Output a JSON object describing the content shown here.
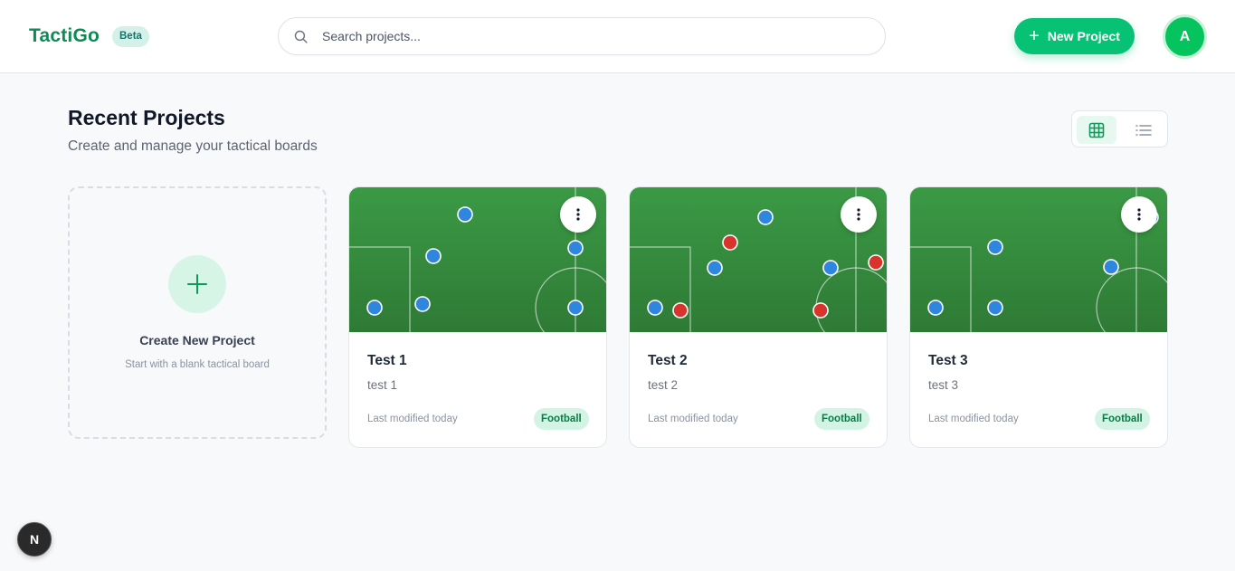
{
  "header": {
    "logo": "TactiGo",
    "badge": "Beta",
    "search_placeholder": "Search projects...",
    "new_project_label": "New Project",
    "avatar_initial": "A"
  },
  "main": {
    "title": "Recent Projects",
    "subtitle": "Create and manage your tactical boards",
    "view_modes": [
      "grid",
      "list"
    ],
    "active_view": "grid"
  },
  "create_card": {
    "title": "Create New Project",
    "subtitle": "Start with a blank tactical board"
  },
  "projects": [
    {
      "title": "Test 1",
      "description": "test 1",
      "modified": "Last modified today",
      "sport": "Football"
    },
    {
      "title": "Test 2",
      "description": "test 2",
      "modified": "Last modified today",
      "sport": "Football"
    },
    {
      "title": "Test 3",
      "description": "test 3",
      "modified": "Last modified today",
      "sport": "Football"
    }
  ],
  "dev_badge": "N",
  "colors": {
    "brand": "#0e8a55",
    "accent": "#07c275",
    "pitch_top": "#3b9a45",
    "pitch_bottom": "#2e7a35",
    "team_blue": "#2f86de",
    "team_red": "#d9342b"
  },
  "icons": [
    "search-icon",
    "plus-icon",
    "grid-view-icon",
    "list-view-icon",
    "more-vertical-icon"
  ]
}
